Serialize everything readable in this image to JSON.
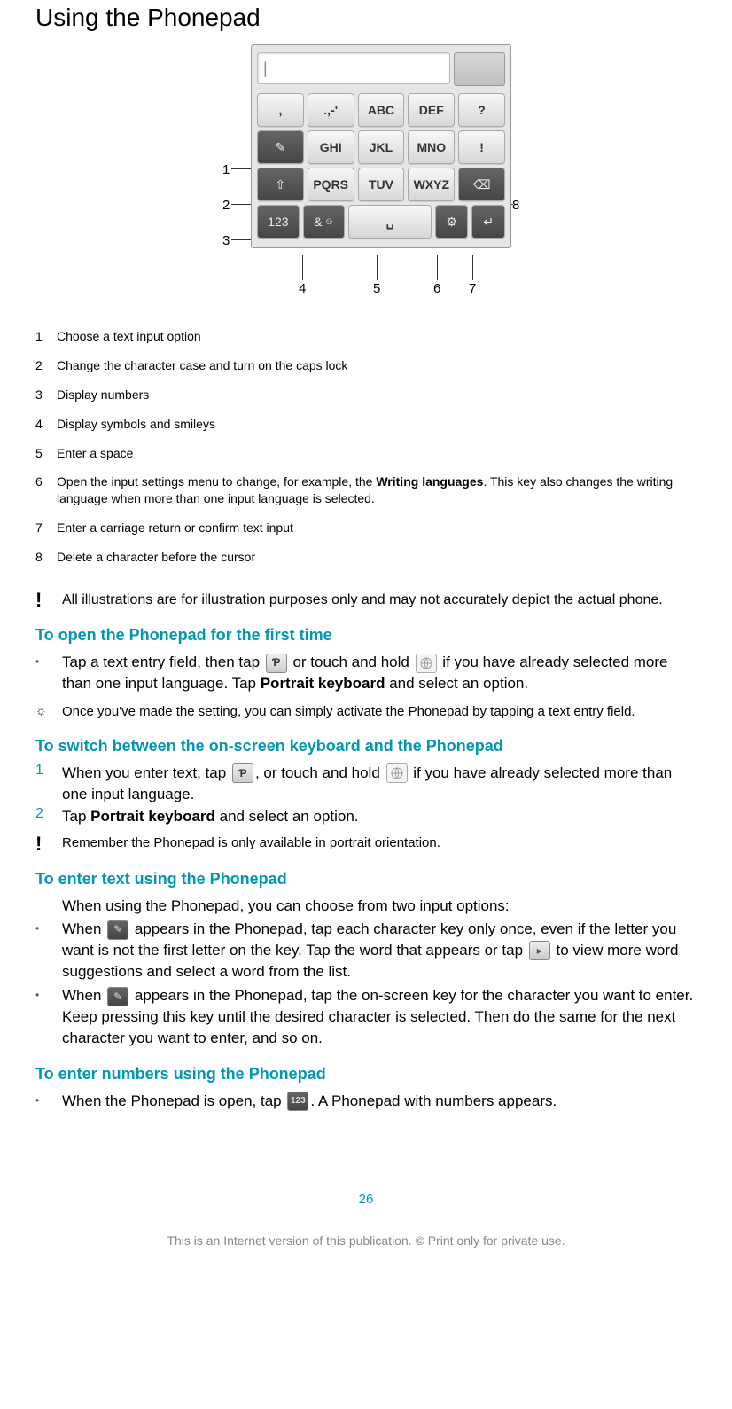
{
  "title": "Using the Phonepad",
  "keypad": {
    "text_cursor": "|",
    "row1": [
      ",",
      ".,-'",
      "ABC",
      "DEF",
      "?"
    ],
    "row2_side": "✎",
    "row2": [
      "GHI",
      "JKL",
      "MNO",
      "!"
    ],
    "row3_side": "⇧",
    "row3": [
      "PQRS",
      "TUV",
      "WXYZ"
    ],
    "row3_del": "⌫",
    "row4": [
      "123",
      "& ",
      "␣",
      "⚙",
      "↵"
    ]
  },
  "callouts": {
    "c1": "1",
    "c2": "2",
    "c3": "3",
    "c4": "4",
    "c5": "5",
    "c6": "6",
    "c7": "7",
    "c8": "8"
  },
  "legend": [
    {
      "n": "1",
      "d": "Choose a text input option"
    },
    {
      "n": "2",
      "d": "Change the character case and turn on the caps lock"
    },
    {
      "n": "3",
      "d": "Display numbers"
    },
    {
      "n": "4",
      "d": "Display symbols and smileys"
    },
    {
      "n": "5",
      "d": "Enter a space"
    },
    {
      "n": "6",
      "d_pre": "Open the input settings menu to change, for example, the ",
      "d_bold": "Writing languages",
      "d_post": ". This key also changes the writing language when more than one input language is selected."
    },
    {
      "n": "7",
      "d": "Enter a carriage return or confirm text input"
    },
    {
      "n": "8",
      "d": "Delete a character before the cursor"
    }
  ],
  "note1": "All illustrations are for illustration purposes only and may not accurately depict the actual phone.",
  "sec1": {
    "head": "To open the Phonepad for the first time",
    "bullet_pre": "Tap a text entry field, then tap ",
    "bullet_mid": " or touch and hold ",
    "bullet_post1": " if you have already selected more than one input language. Tap ",
    "bullet_bold": "Portrait keyboard",
    "bullet_post2": " and select an option.",
    "tip": "Once you've made the setting, you can simply activate the Phonepad by tapping a text entry field."
  },
  "sec2": {
    "head": "To switch between the on-screen keyboard and the Phonepad",
    "step1_n": "1",
    "step1_pre": "When you enter text, tap ",
    "step1_mid": ", or touch and hold ",
    "step1_post": " if you have already selected more than one input language.",
    "step2_n": "2",
    "step2_pre": "Tap ",
    "step2_bold": "Portrait keyboard",
    "step2_post": " and select an option.",
    "note": "Remember the Phonepad is only available in portrait orientation."
  },
  "sec3": {
    "head": "To enter text using the Phonepad",
    "intro": "When using the Phonepad, you can choose from two input options:",
    "b1_pre": "When ",
    "b1_mid": " appears in the Phonepad, tap each character key only once, even if the letter you want is not the first letter on the key. Tap the word that appears or tap ",
    "b1_post": " to view more word suggestions and select a word from the list.",
    "b2_pre": "When ",
    "b2_post": " appears in the Phonepad, tap the on-screen key for the character you want to enter. Keep pressing this key until the desired character is selected. Then do the same for the next character you want to enter, and so on."
  },
  "sec4": {
    "head": "To enter numbers using the Phonepad",
    "b_pre": "When the Phonepad is open, tap ",
    "b_post": ". A Phonepad with numbers appears."
  },
  "footer": {
    "page": "26",
    "note": "This is an Internet version of this publication. © Print only for private use."
  },
  "icons": {
    "num123": "123"
  }
}
